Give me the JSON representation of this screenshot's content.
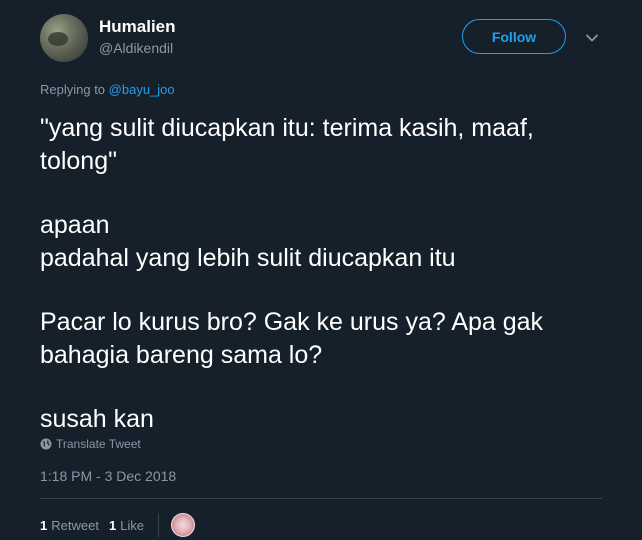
{
  "user": {
    "display_name": "Humalien",
    "handle": "@Aldikendil"
  },
  "follow_label": "Follow",
  "reply": {
    "prefix": "Replying to",
    "mention": "@bayu_joo"
  },
  "tweet": {
    "lines": [
      "\"yang sulit diucapkan itu: terima kasih, maaf, tolong\"",
      "apaan",
      "padahal yang lebih sulit diucapkan itu",
      "Pacar lo kurus bro? Gak ke urus ya? Apa gak bahagia bareng sama lo?",
      "susah kan"
    ]
  },
  "translate_label": "Translate Tweet",
  "timestamp": "1:18 PM - 3 Dec 2018",
  "stats": {
    "retweets_count": "1",
    "retweets_label": "Retweet",
    "likes_count": "1",
    "likes_label": "Like"
  },
  "colors": {
    "background": "#15202b",
    "accent": "#1da1f2",
    "secondary_text": "#8899a6"
  },
  "icons": {
    "caret": "chevron-down-icon",
    "translate": "globe-icon"
  }
}
